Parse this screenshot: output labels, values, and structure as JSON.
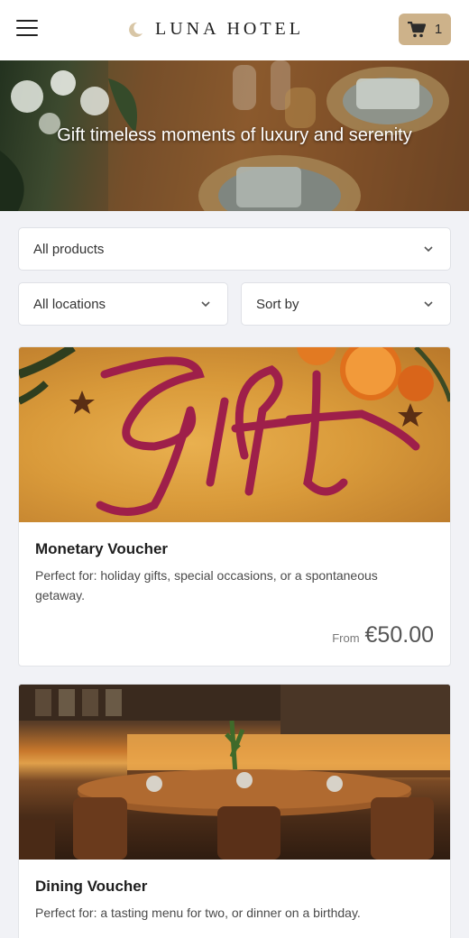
{
  "header": {
    "brand": "LUNA HOTEL",
    "cart_count": "1",
    "icons": {
      "menu": "hamburger-icon",
      "logo": "crescent-moon-icon",
      "cart": "cart-icon"
    }
  },
  "hero": {
    "title": "Gift timeless moments of luxury and serenity"
  },
  "filters": {
    "product": "All products",
    "location": "All locations",
    "sort": "Sort by"
  },
  "products": [
    {
      "title": "Monetary Voucher",
      "description": "Perfect for: holiday gifts, special occasions, or a spontaneous getaway.",
      "price_prefix": "From",
      "price": "€50.00",
      "image_text": "Gift"
    },
    {
      "title": "Dining Voucher",
      "description": "Perfect for: a tasting menu for two, or dinner on a birthday."
    }
  ],
  "colors": {
    "accent": "#cdb28a",
    "background": "#f1f2f6"
  }
}
